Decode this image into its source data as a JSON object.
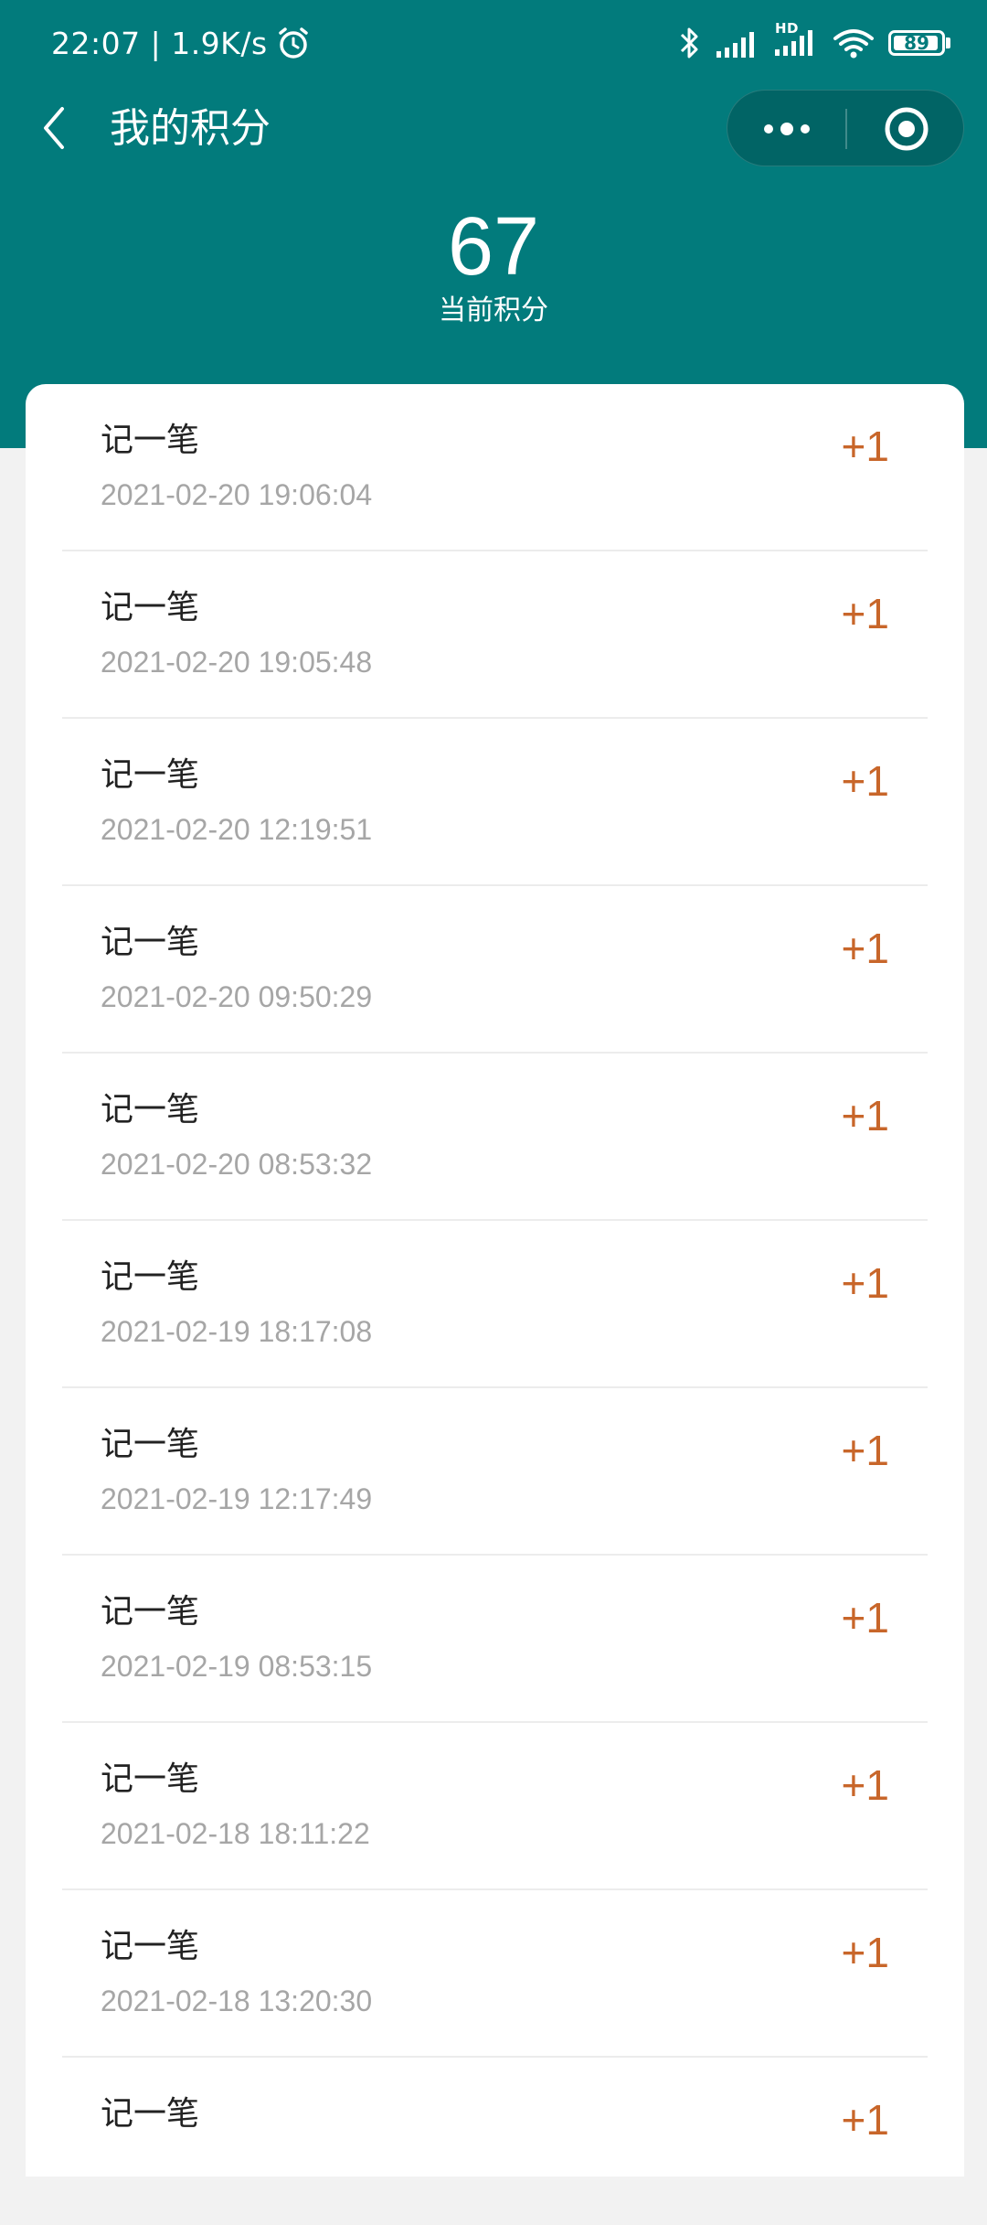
{
  "status_bar": {
    "time_speed": "22:07 | 1.9K/s",
    "hd_label": "HD",
    "battery": "89"
  },
  "navbar": {
    "title": "我的积分"
  },
  "points": {
    "value": "67",
    "label": "当前积分"
  },
  "records": [
    {
      "title": "记一笔",
      "time": "2021-02-20 19:06:04",
      "delta": "+1"
    },
    {
      "title": "记一笔",
      "time": "2021-02-20 19:05:48",
      "delta": "+1"
    },
    {
      "title": "记一笔",
      "time": "2021-02-20 12:19:51",
      "delta": "+1"
    },
    {
      "title": "记一笔",
      "time": "2021-02-20 09:50:29",
      "delta": "+1"
    },
    {
      "title": "记一笔",
      "time": "2021-02-20 08:53:32",
      "delta": "+1"
    },
    {
      "title": "记一笔",
      "time": "2021-02-19 18:17:08",
      "delta": "+1"
    },
    {
      "title": "记一笔",
      "time": "2021-02-19 12:17:49",
      "delta": "+1"
    },
    {
      "title": "记一笔",
      "time": "2021-02-19 08:53:15",
      "delta": "+1"
    },
    {
      "title": "记一笔",
      "time": "2021-02-18 18:11:22",
      "delta": "+1"
    },
    {
      "title": "记一笔",
      "time": "2021-02-18 13:20:30",
      "delta": "+1"
    },
    {
      "title": "记一笔",
      "time": "",
      "delta": "+1"
    }
  ],
  "colors": {
    "header": "#027b7c",
    "delta": "#c8662a"
  }
}
